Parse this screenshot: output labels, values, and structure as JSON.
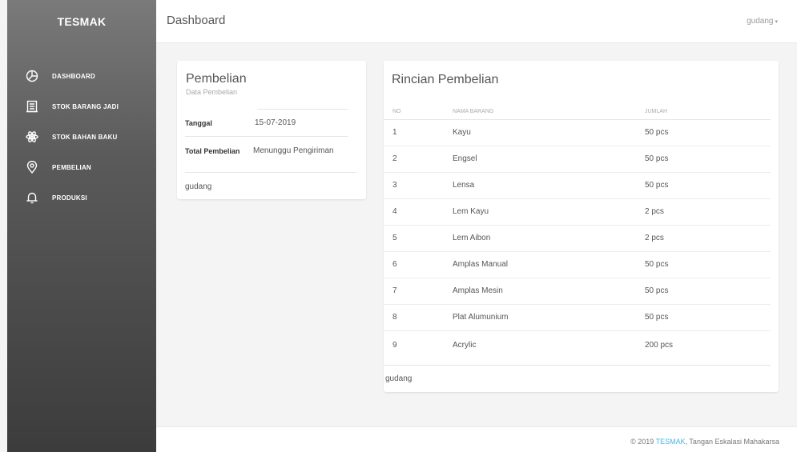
{
  "sidebar": {
    "brand": "TESMAK",
    "items": [
      {
        "label": "DASHBOARD",
        "icon": "pie-chart-icon"
      },
      {
        "label": "STOK BARANG JADI",
        "icon": "document-icon"
      },
      {
        "label": "STOK BAHAN BAKU",
        "icon": "atom-icon"
      },
      {
        "label": "PEMBELIAN",
        "icon": "map-pin-icon"
      },
      {
        "label": "PRODUKSI",
        "icon": "bell-icon"
      }
    ]
  },
  "header": {
    "title": "Dashboard",
    "user": "gudang",
    "caret": "▾"
  },
  "purchase_card": {
    "title": "Pembelian",
    "subtitle": "Data Pembelian",
    "date_label": "Tanggal",
    "date_value": "15-07-2019",
    "total_label": "Total Pembelian",
    "total_value": "Menunggu Pengiriman",
    "footer": "gudang"
  },
  "detail_card": {
    "title": "Rincian Pembelian",
    "columns": [
      "NO",
      "NAMA BARANG",
      "JUMLAH"
    ],
    "rows": [
      [
        "1",
        "Kayu",
        "50 pcs"
      ],
      [
        "2",
        "Engsel",
        "50 pcs"
      ],
      [
        "3",
        "Lensa",
        "50 pcs"
      ],
      [
        "4",
        "Lem Kayu",
        "2 pcs"
      ],
      [
        "5",
        "Lem Aibon",
        "2 pcs"
      ],
      [
        "6",
        "Amplas Manual",
        "50 pcs"
      ],
      [
        "7",
        "Amplas Mesin",
        "50 pcs"
      ],
      [
        "8",
        "Plat Alumunium",
        "50 pcs"
      ],
      [
        "9",
        "Acrylic",
        "200 pcs"
      ]
    ],
    "footer": "gudang"
  },
  "footer": {
    "prefix": "© 2019 ",
    "brand": "TESMAK",
    "suffix": ", Tangan Eskalasi Mahakarsa"
  }
}
